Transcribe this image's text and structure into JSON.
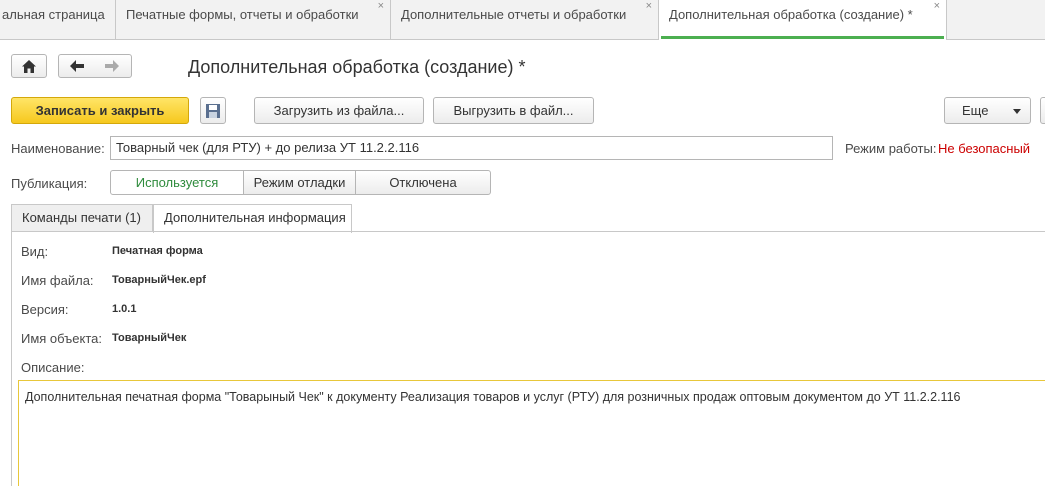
{
  "tabs": [
    {
      "label": "альная страница"
    },
    {
      "label": "Печатные формы, отчеты и обработки"
    },
    {
      "label": "Дополнительные отчеты и обработки"
    },
    {
      "label": "Дополнительная обработка (создание) *"
    }
  ],
  "window": {
    "title": "Дополнительная обработка (создание) *"
  },
  "toolbar": {
    "save_close_label": "Записать и закрыть",
    "load_label": "Загрузить из файла...",
    "export_label": "Выгрузить в файл...",
    "more_label": "Еще"
  },
  "form": {
    "name_label": "Наименование:",
    "name_value": "Товарный чек (для РТУ) + до релиза УТ 11.2.2.116",
    "mode_label": "Режим работы:",
    "mode_value": "Не безопасный",
    "mode_value_color": "#cc0000",
    "publication_label": "Публикация:",
    "publication_options": [
      "Используется",
      "Режим отладки",
      "Отключена"
    ],
    "publication_selected": "Используется"
  },
  "form_tabs": [
    {
      "label": "Команды печати (1)"
    },
    {
      "label": "Дополнительная информация"
    }
  ],
  "info": {
    "kind_label": "Вид:",
    "kind_value": "Печатная форма",
    "file_label": "Имя файла:",
    "file_value": "ТоварныйЧек.epf",
    "version_label": "Версия:",
    "version_value": "1.0.1",
    "object_label": "Имя объекта:",
    "object_value": "ТоварныйЧек",
    "description_label": "Описание:",
    "description_value": "Дополнительная печатная форма \"Товарыный Чек\" к документу Реализация товаров и услуг (РТУ) для розничных продаж оптовым документом до УТ 11.2.2.116"
  },
  "colors": {
    "accent": "#4caf50",
    "primary_button": "#f6c81e",
    "warning": "#cc0000"
  }
}
